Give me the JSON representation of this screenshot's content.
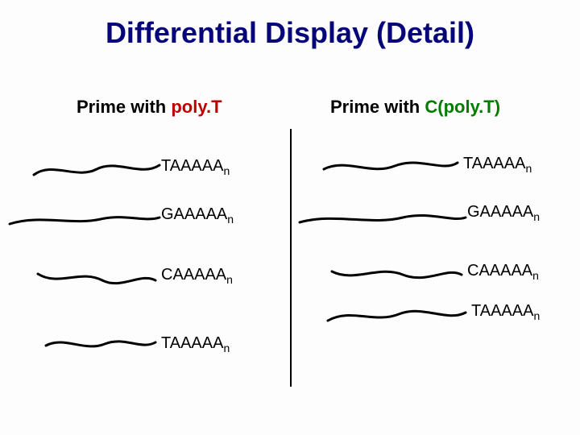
{
  "title": "Differential Display (Detail)",
  "left": {
    "heading_prefix": "Prime with ",
    "heading_term": "poly.T",
    "bands": [
      {
        "label_base": "TAAAAA",
        "label_sub": "n"
      },
      {
        "label_base": "GAAAAA",
        "label_sub": "n"
      },
      {
        "label_base": "CAAAAA",
        "label_sub": "n"
      },
      {
        "label_base": "TAAAAA",
        "label_sub": "n"
      }
    ]
  },
  "right": {
    "heading_prefix": "Prime with ",
    "heading_term": "C(poly.T)",
    "bands": [
      {
        "label_base": "TAAAAA",
        "label_sub": "n"
      },
      {
        "label_base": "GAAAAA",
        "label_sub": "n"
      },
      {
        "label_base": "CAAAAA",
        "label_sub": "n"
      },
      {
        "label_base": "TAAAAA",
        "label_sub": "n"
      }
    ]
  }
}
